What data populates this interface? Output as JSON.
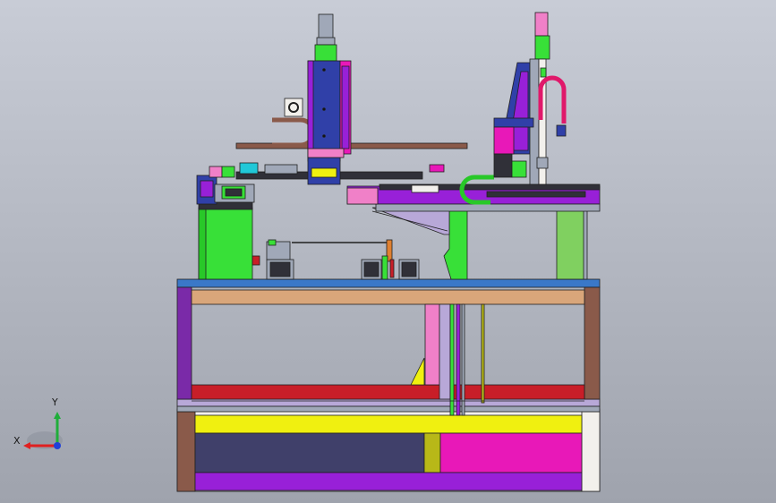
{
  "viewport": {
    "background_top": "#c8ccd6",
    "background_bottom": "#9fa3ad"
  },
  "triad": {
    "x_label": "X",
    "y_label": "Y",
    "x_color": "#e02020",
    "y_color": "#1fae3a",
    "z_color": "#2040d8"
  },
  "colors": {
    "frame_top": "#3a78c8",
    "wood": "#d9a67a",
    "purple": "#7a2aa8",
    "brown": "#8a5a4a",
    "red": "#c81e28",
    "yellow": "#f0f010",
    "navy": "#40406a",
    "magenta": "#e818b8",
    "olive": "#b8b818",
    "violet": "#9820d8",
    "green": "#38e038",
    "green2": "#28c828",
    "lime": "#80d060",
    "blue": "#3040a8",
    "pink": "#f080c8",
    "lavender": "#b8a8d8",
    "steel": "#a0a8b8",
    "dark": "#303038",
    "cyan": "#20c8d8",
    "white": "#f2f0ec",
    "orange": "#e08030"
  }
}
